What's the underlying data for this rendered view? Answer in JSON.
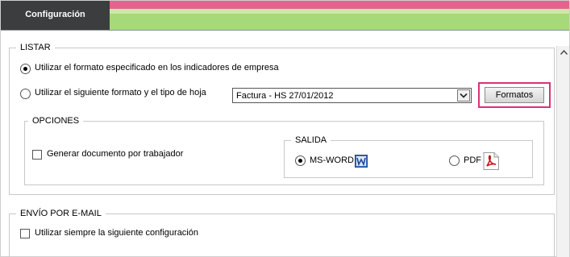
{
  "header": {
    "tab_title": "Configuración"
  },
  "listar": {
    "legend": "LISTAR",
    "option_company_label": "Utilizar el formato especificado en los indicadores de empresa",
    "option_custom_label": "Utilizar el siguiente formato y el tipo de hoja",
    "format_select_value": "Factura - HS 27/01/2012",
    "formatos_button": "Formatos"
  },
  "opciones": {
    "legend": "OPCIONES",
    "generate_per_worker_label": "Generar documento por trabajador"
  },
  "salida": {
    "legend": "SALIDA",
    "msword_label": "MS-WORD",
    "pdf_label": "PDF"
  },
  "email": {
    "legend": "ENVÍO POR E-MAIL",
    "always_use_label": "Utilizar siempre la siguiente configuración"
  },
  "colors": {
    "header_dark": "#3b3d3f",
    "header_pink": "#e8618e",
    "header_green": "#a6d97a",
    "highlight": "#d8327a"
  },
  "icons": [
    "chevron-up-icon",
    "chevron-down-icon",
    "word-icon",
    "pdf-icon"
  ]
}
